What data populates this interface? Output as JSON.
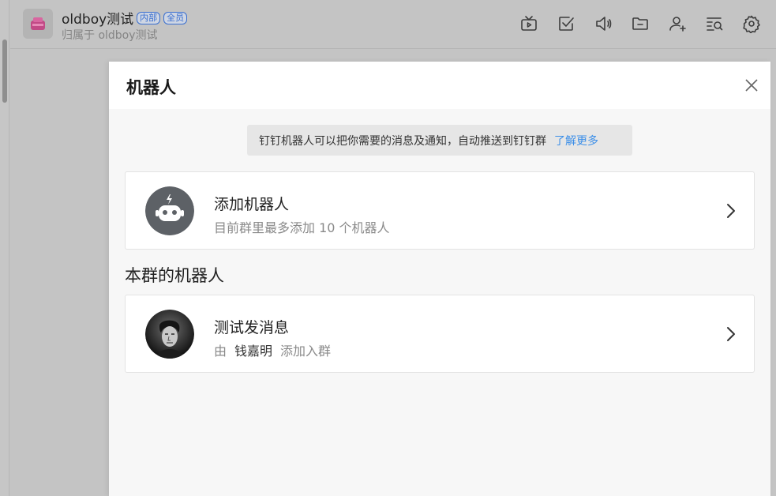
{
  "header": {
    "group_name": "oldboy测试",
    "badges": [
      "内部",
      "全员"
    ],
    "owner_text": "归属于 oldboy测试",
    "toolbar_icons": [
      "tv-icon",
      "checkbox-icon",
      "announcement-icon",
      "folder-icon",
      "add-member-icon",
      "search-history-icon",
      "settings-icon"
    ]
  },
  "panel": {
    "title": "机器人",
    "notice_text": "钉钉机器人可以把你需要的消息及通知，自动推送到钉钉群",
    "notice_link": "了解更多",
    "add_card": {
      "title": "添加机器人",
      "subtitle": "目前群里最多添加 10 个机器人"
    },
    "section_title": "本群的机器人",
    "bots": [
      {
        "name": "测试发消息",
        "prefix": "由",
        "added_by": "钱嘉明",
        "suffix": "添加入群"
      }
    ]
  },
  "colors": {
    "link": "#3b8ee8",
    "badge": "#3a6fd0",
    "robot_icon_bg": "#5d6166"
  }
}
